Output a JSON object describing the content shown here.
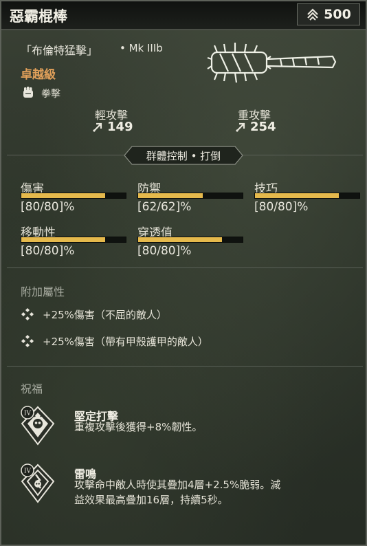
{
  "header": {
    "title": "惡霸棍棒",
    "price": "500",
    "price_icon": "chevron-rank-icon"
  },
  "weapon": {
    "subtitle": "「布倫特猛擊」",
    "mark": "• Mk IIIb",
    "tier": "卓越級",
    "damage_type": "拳擊",
    "damage_type_icon": "fist-icon",
    "image_icon": "spiked-club-icon",
    "tier_color": "#e1a05a"
  },
  "attacks": {
    "light": {
      "label": "輕攻擊",
      "value": "149"
    },
    "heavy": {
      "label": "重攻擊",
      "value": "254"
    }
  },
  "tag": "群體控制 • 打倒",
  "stats": [
    {
      "label": "傷害",
      "value": "[80/80]%",
      "fill": 0.8
    },
    {
      "label": "防禦",
      "value": "[62/62]%",
      "fill": 0.62
    },
    {
      "label": "技巧",
      "value": "[80/80]%",
      "fill": 0.8
    },
    {
      "label": "移動性",
      "value": "[80/80]%",
      "fill": 0.8
    },
    {
      "label": "穿透值",
      "value": "[80/80]%",
      "fill": 0.8
    }
  ],
  "bar_color": "#e5b94c",
  "perks": {
    "heading": "附加屬性",
    "items": [
      {
        "text": "+25%傷害（不屈的敵人）",
        "icon": "diamond-cluster-icon"
      },
      {
        "text": "+25%傷害（帶有甲殼護甲的敵人）",
        "icon": "diamond-cluster-icon"
      }
    ]
  },
  "blessings": {
    "heading": "祝福",
    "items": [
      {
        "name": "堅定打擊",
        "tier": "IV",
        "icon": "skull-shield-blessing-icon",
        "desc": [
          "重複攻擊後獲得+8%韌性。"
        ]
      },
      {
        "name": "雷鳴",
        "tier": "IV",
        "icon": "thunder-skull-blessing-icon",
        "desc": [
          "攻擊命中敵人時使其疊加4層+2.5%脆弱。減",
          "益效果最高疊加16層，持續5秒。"
        ]
      }
    ]
  }
}
